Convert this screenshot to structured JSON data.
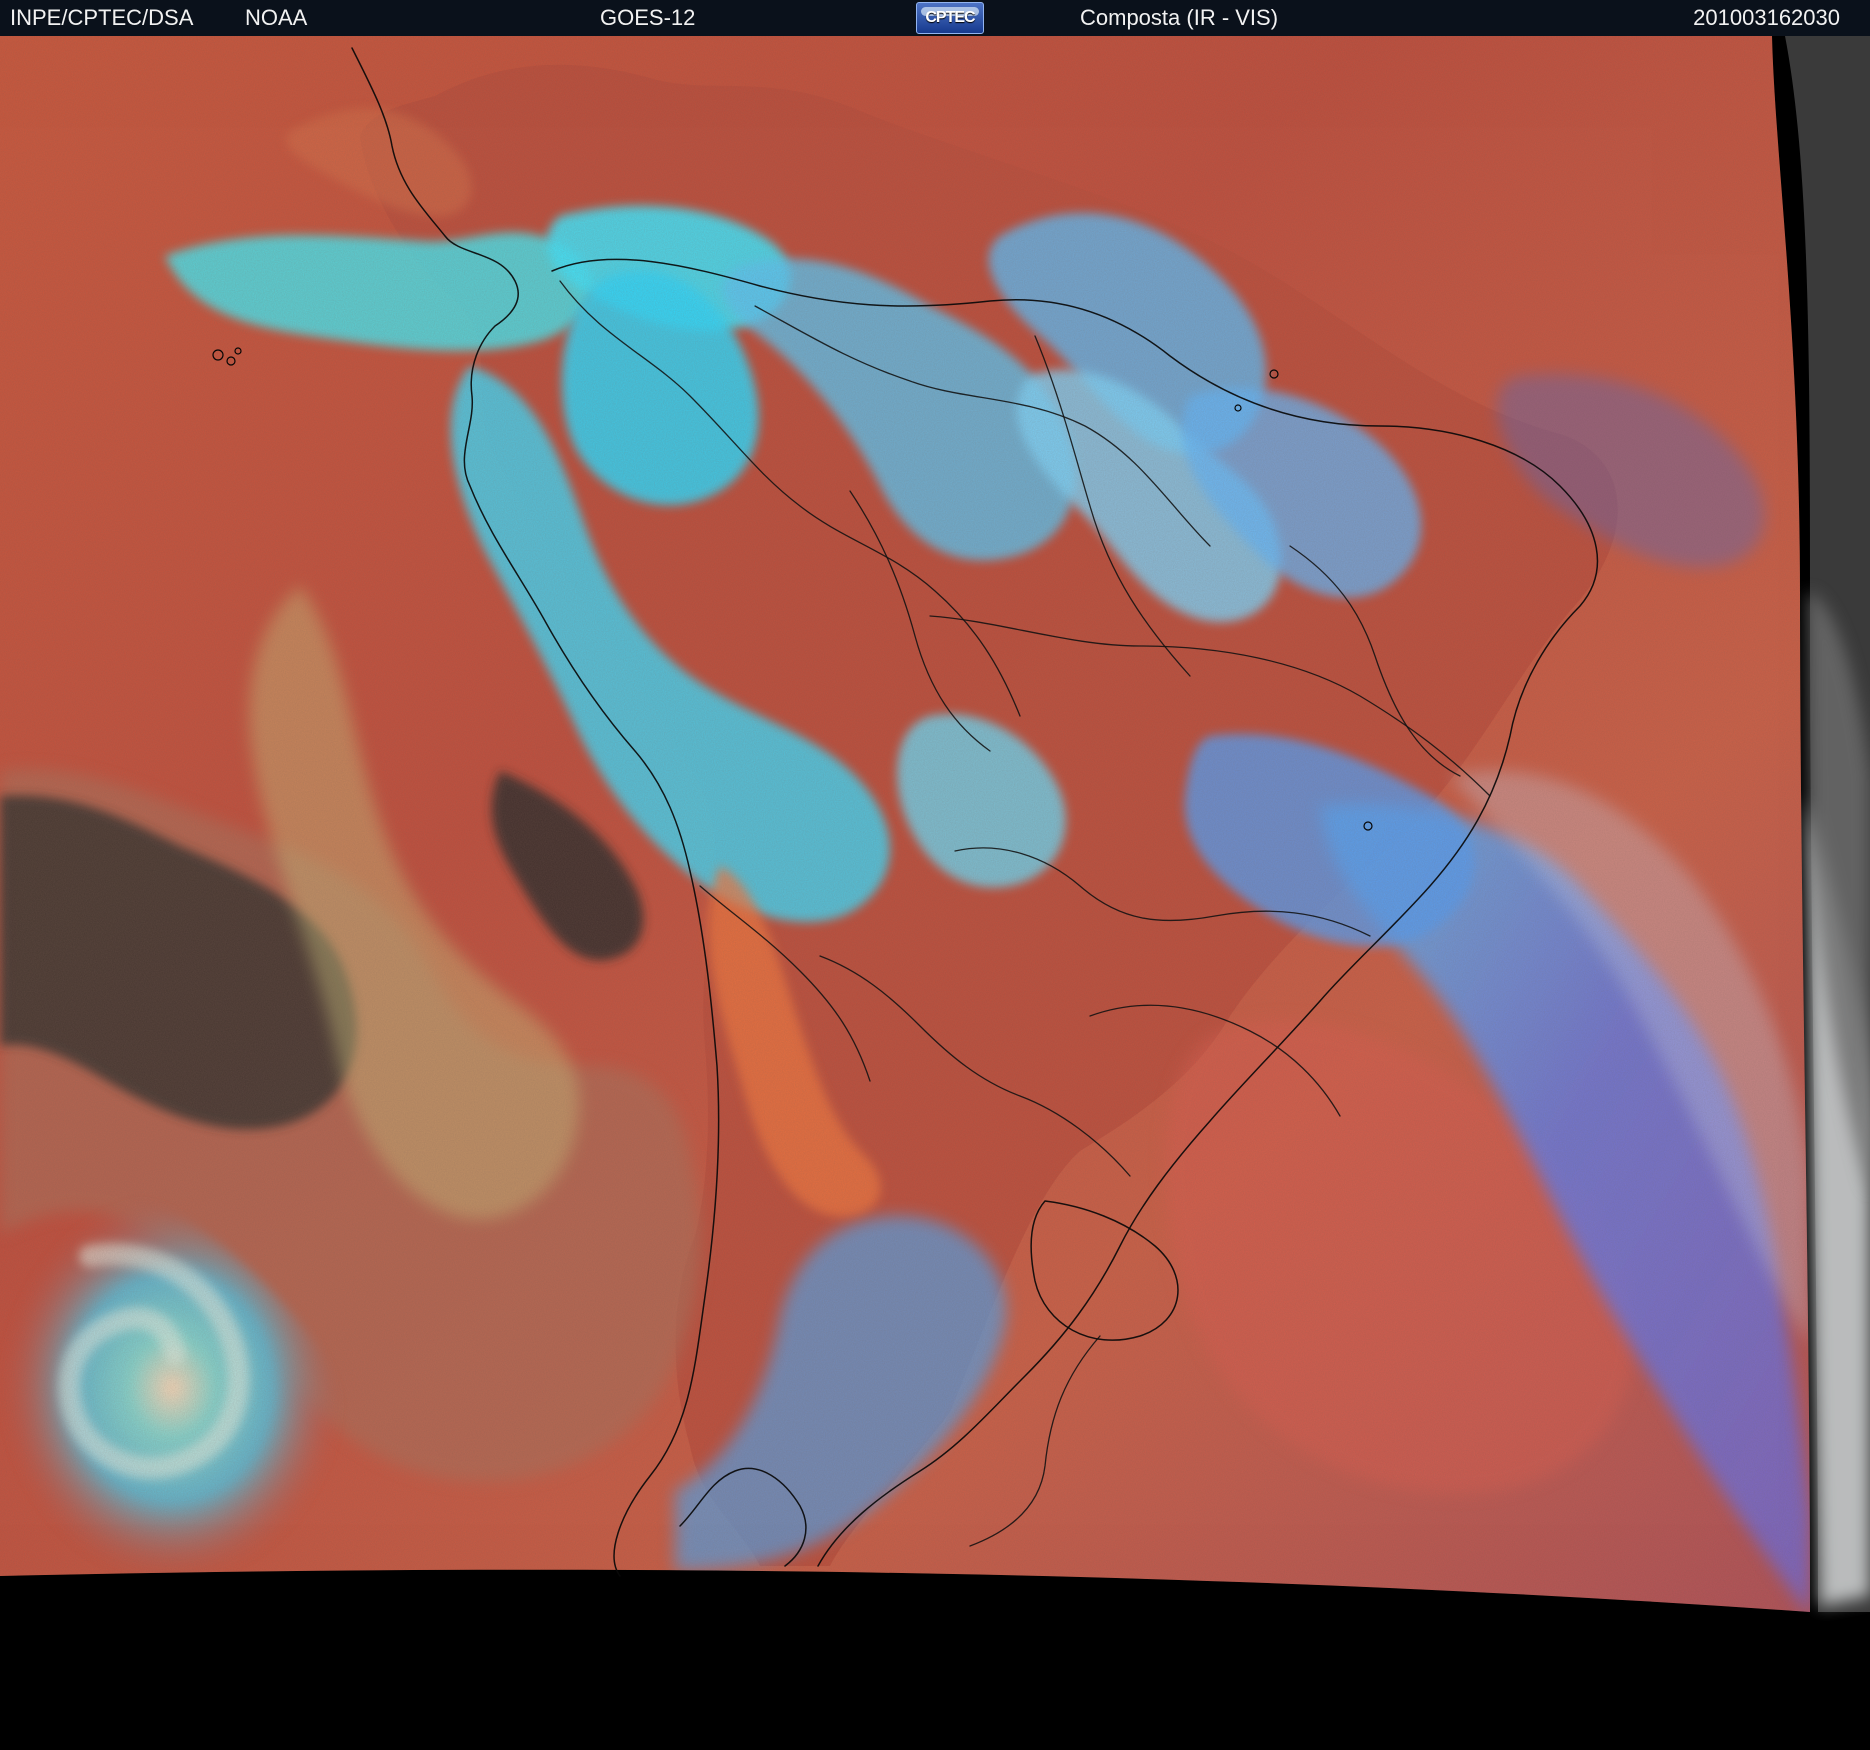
{
  "header": {
    "source": "INPE/CPTEC/DSA",
    "agency": "NOAA",
    "satellite": "GOES-12",
    "logo_text": "CPTEC",
    "product": "Composta (IR - VIS)",
    "datetime": "201003162030"
  },
  "colors": {
    "header_background": "#0a111b",
    "clear_ocean": "#c24a38",
    "land": "#b74a37",
    "high_cloud": "#29dcf6",
    "low_cloud": "#9fc27d",
    "dark_cloud": "#282726",
    "outside_disk": "#000000"
  },
  "icons": {
    "logo": "cptec-logo"
  }
}
